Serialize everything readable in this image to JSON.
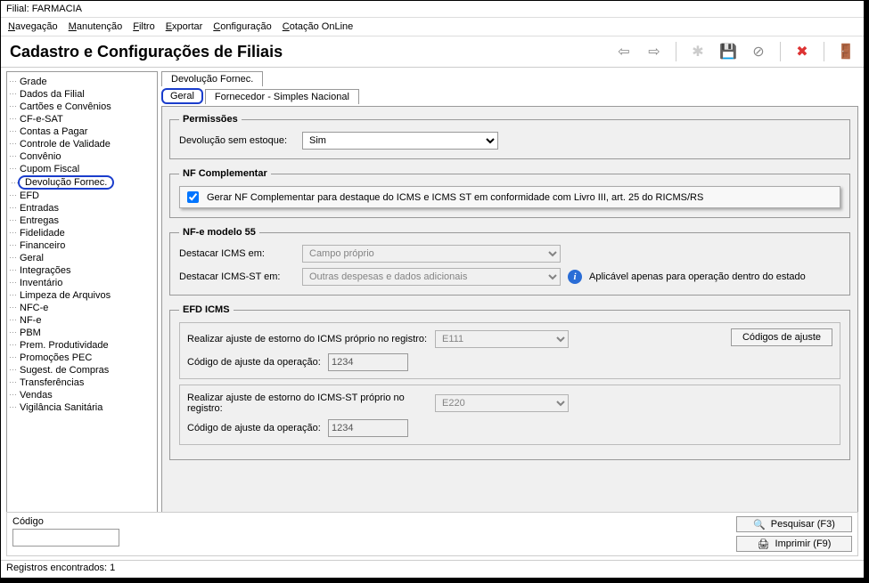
{
  "window": {
    "title": "Filial: FARMACIA"
  },
  "menu": {
    "navegacao": "Navegação",
    "manutencao": "Manutenção",
    "filtro": "Filtro",
    "exportar": "Exportar",
    "configuracao": "Configuração",
    "cotacao": "Cotação OnLine"
  },
  "page": {
    "title": "Cadastro e Configurações de Filiais"
  },
  "sidebar": {
    "items": [
      "Grade",
      "Dados da Filial",
      "Cartões e Convênios",
      "CF-e-SAT",
      "Contas a Pagar",
      "Controle de Validade",
      "Convênio",
      "Cupom Fiscal",
      "Devolução Fornec.",
      "EFD",
      "Entradas",
      "Entregas",
      "Fidelidade",
      "Financeiro",
      "Geral",
      "Integrações",
      "Inventário",
      "Limpeza de Arquivos",
      "NFC-e",
      "NF-e",
      "PBM",
      "Prem. Produtividade",
      "Promoções PEC",
      "Sugest. de Compras",
      "Transferências",
      "Vendas",
      "Vigilância Sanitária"
    ],
    "selected_index": 8
  },
  "tabs": {
    "top": {
      "label": "Devolução Fornec."
    },
    "sub": [
      {
        "label": "Geral",
        "selected": true
      },
      {
        "label": "Fornecedor - Simples Nacional",
        "selected": false
      }
    ]
  },
  "permissoes": {
    "legend": "Permissões",
    "devolucao_sem_estoque_label": "Devolução sem estoque:",
    "devolucao_sem_estoque_value": "Sim"
  },
  "nf_complementar": {
    "legend": "NF Complementar",
    "checkbox_label": "Gerar NF Complementar para destaque do ICMS e ICMS ST em conformidade com Livro III, art. 25 do RICMS/RS",
    "checked": true
  },
  "nfe55": {
    "legend": "NF-e modelo 55",
    "destacar_icms_label": "Destacar ICMS em:",
    "destacar_icms_value": "Campo próprio",
    "destacar_icmsst_label": "Destacar ICMS-ST em:",
    "destacar_icmsst_value": "Outras despesas e dados adicionais",
    "info_text": "Aplicável apenas para operação dentro do estado"
  },
  "efd_icms": {
    "legend": "EFD ICMS",
    "codigos_ajuste_btn": "Códigos de ajuste",
    "box1": {
      "realizar_label": "Realizar ajuste de estorno do ICMS próprio no registro:",
      "realizar_value": "E111",
      "codigo_label": "Código de ajuste da operação:",
      "codigo_value": "1234"
    },
    "box2": {
      "realizar_label": "Realizar ajuste de estorno do ICMS-ST próprio no registro:",
      "realizar_value": "E220",
      "codigo_label": "Código de ajuste da operação:",
      "codigo_value": "1234"
    }
  },
  "footer": {
    "codigo_label": "Código",
    "pesquisar": "Pesquisar (F3)",
    "imprimir": "Imprimir (F9)"
  },
  "status": {
    "text": "Registros encontrados: 1"
  }
}
